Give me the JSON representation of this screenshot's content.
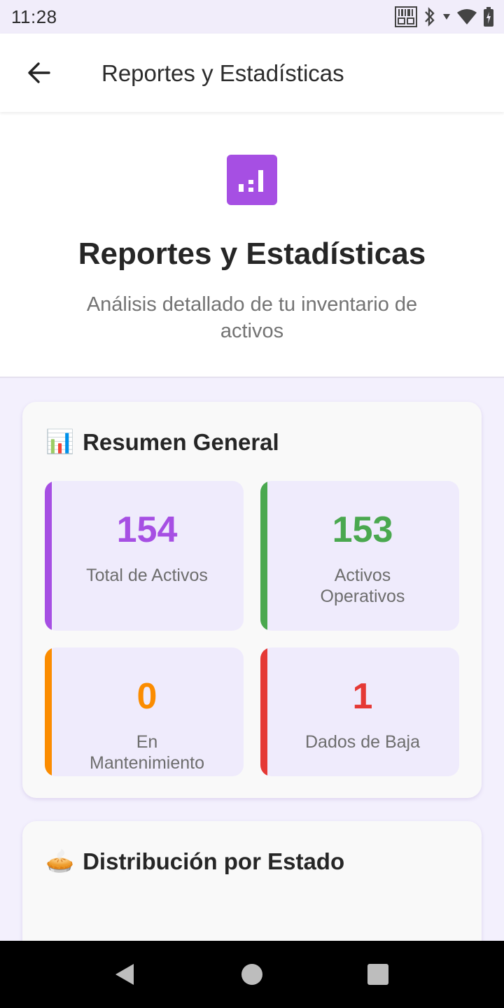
{
  "status_bar": {
    "time": "11:28"
  },
  "app_bar": {
    "title": "Reportes y Estadísticas"
  },
  "hero": {
    "title": "Reportes y Estadísticas",
    "subtitle": "Análisis detallado de tu inventario de activos"
  },
  "summary": {
    "emoji": "📊",
    "title": "Resumen General",
    "stats": [
      {
        "value": "154",
        "label": "Total de Activos",
        "color": "#a64fe3"
      },
      {
        "value": "153",
        "label": "Activos Operativos",
        "color": "#4aa84f"
      },
      {
        "value": "0",
        "label": "En Mantenimiento",
        "color": "#fb8c00"
      },
      {
        "value": "1",
        "label": "Dados de Baja",
        "color": "#e53935"
      }
    ]
  },
  "distribution": {
    "emoji": "🥧",
    "title": "Distribución por Estado"
  },
  "colors": {
    "accent": "#a64fe3",
    "background": "#f3f0fd",
    "card": "#f9f9f9",
    "stat_bg": "#efebfc"
  }
}
